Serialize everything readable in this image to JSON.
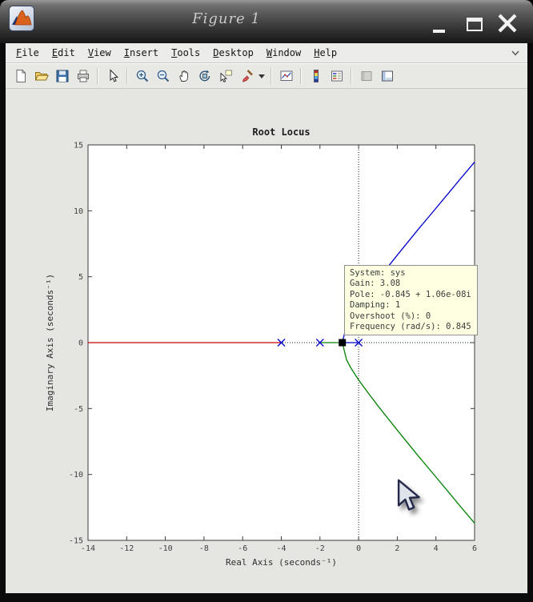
{
  "window": {
    "title": "Figure 1",
    "control_icons": [
      "minimize-icon",
      "maximize-icon",
      "close-icon"
    ],
    "logo_icon": "matlab-logo-icon"
  },
  "menu": {
    "items": [
      {
        "label": "File"
      },
      {
        "label": "Edit"
      },
      {
        "label": "View"
      },
      {
        "label": "Insert"
      },
      {
        "label": "Tools"
      },
      {
        "label": "Desktop"
      },
      {
        "label": "Window"
      },
      {
        "label": "Help"
      }
    ],
    "overflow_icon": "chevron-down-icon"
  },
  "toolbar": {
    "icons": [
      "new-file-icon",
      "open-file-icon",
      "save-icon",
      "print-icon",
      "pointer-icon",
      "zoom-in-icon",
      "zoom-out-icon",
      "pan-hand-icon",
      "rotate-3d-icon",
      "data-cursor-icon",
      "brush-icon",
      "brush-dropdown-icon",
      "link-plots-icon",
      "insert-colorbar-icon",
      "insert-legend-icon",
      "hide-plot-tools-icon",
      "show-plot-tools-icon"
    ]
  },
  "datatip": {
    "bg_color": "#ffffe1",
    "lines": [
      "System: sys",
      "Gain: 3.08",
      "Pole: -0.845 + 1.06e-08i",
      "Damping: 1",
      "Overshoot (%): 0",
      "Frequency (rad/s): 0.845"
    ]
  },
  "chart_data": {
    "type": "line",
    "title": "Root Locus",
    "xlabel": "Real Axis (seconds⁻¹)",
    "ylabel": "Imaginary Axis (seconds⁻¹)",
    "xlim": [
      -14,
      6
    ],
    "ylim": [
      -15,
      15
    ],
    "xticks": [
      -14,
      -12,
      -10,
      -8,
      -6,
      -4,
      -2,
      0,
      2,
      4,
      6
    ],
    "yticks": [
      -15,
      -10,
      -5,
      0,
      5,
      10,
      15
    ],
    "grid": false,
    "legend": "none",
    "reference_lines": {
      "vertical_x": 0,
      "horizontal_y": 0,
      "style": "dotted",
      "color": "#222222"
    },
    "pole_marker_color": "#0000cc",
    "poles_x_markers": [
      [
        -4,
        0
      ],
      [
        -2,
        0
      ],
      [
        0,
        0
      ]
    ],
    "selected_point": {
      "x": -0.845,
      "y": 0,
      "marker": "filled-square",
      "color": "#000000"
    },
    "series": [
      {
        "name": "real-axis-branch-red",
        "color": "#cc0000",
        "points": [
          [
            -14,
            0
          ],
          [
            -4,
            0
          ]
        ]
      },
      {
        "name": "real-axis-branch-green",
        "color": "#008000",
        "points": [
          [
            -2,
            0
          ],
          [
            -0.845,
            0
          ]
        ]
      },
      {
        "name": "real-axis-branch-blue",
        "color": "#0000cc",
        "points": [
          [
            0,
            0
          ],
          [
            -0.845,
            0
          ]
        ]
      },
      {
        "name": "complex-branch-upper-blue",
        "color": "#0000cc",
        "points": [
          [
            -0.845,
            0
          ],
          [
            -0.62,
            1.31
          ],
          [
            -0.4,
            1.92
          ],
          [
            0,
            2.83
          ],
          [
            0.47,
            3.77
          ],
          [
            1.04,
            4.87
          ],
          [
            2.05,
            6.73
          ],
          [
            3.06,
            8.55
          ],
          [
            3.78,
            9.81
          ],
          [
            4.84,
            11.67
          ],
          [
            5.26,
            12.41
          ],
          [
            6,
            13.7
          ]
        ]
      },
      {
        "name": "complex-branch-lower-green",
        "color": "#008000",
        "points": [
          [
            -0.845,
            0
          ],
          [
            -0.62,
            -1.31
          ],
          [
            -0.4,
            -1.92
          ],
          [
            0,
            -2.83
          ],
          [
            0.47,
            -3.77
          ],
          [
            1.04,
            -4.87
          ],
          [
            2.05,
            -6.73
          ],
          [
            3.06,
            -8.55
          ],
          [
            3.78,
            -9.81
          ],
          [
            4.84,
            -11.67
          ],
          [
            5.26,
            -12.41
          ],
          [
            6,
            -13.7
          ]
        ]
      }
    ]
  }
}
